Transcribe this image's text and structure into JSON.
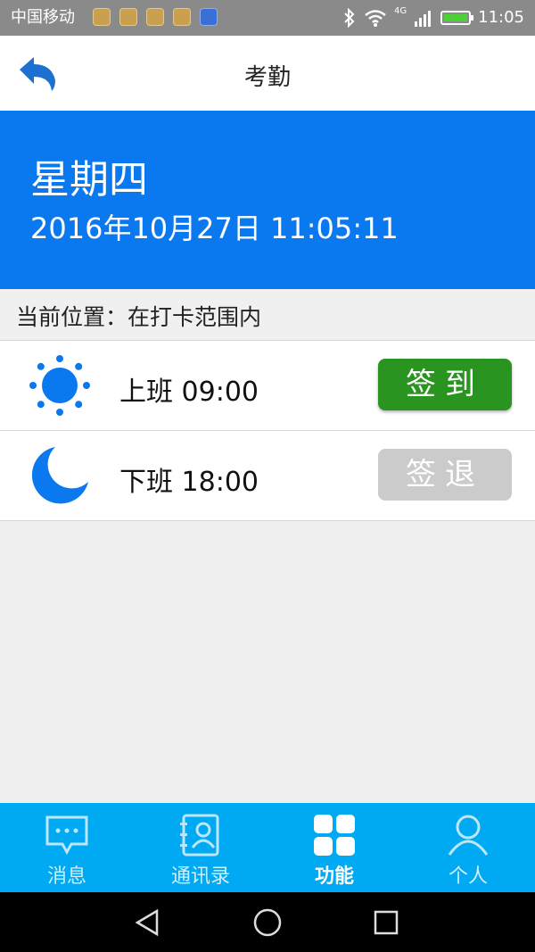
{
  "status_bar": {
    "carrier": "中国移动",
    "network": "4G",
    "time": "11:05"
  },
  "header": {
    "title": "考勤"
  },
  "banner": {
    "weekday": "星期四",
    "datetime": "2016年10月27日 11:05:11"
  },
  "location": {
    "text": "当前位置：在打卡范围内"
  },
  "rows": [
    {
      "label": "上班 09:00",
      "icon": "sun-icon",
      "button": "签到",
      "button_color": "#2a9421",
      "enabled": true
    },
    {
      "label": "下班 18:00",
      "icon": "moon-icon",
      "button": "签退",
      "button_color": "#cbcbcb",
      "enabled": false
    }
  ],
  "nav": [
    {
      "label": "消息",
      "icon": "message-icon",
      "active": false
    },
    {
      "label": "通讯录",
      "icon": "contacts-icon",
      "active": false
    },
    {
      "label": "功能",
      "icon": "grid-icon",
      "active": true
    },
    {
      "label": "个人",
      "icon": "person-icon",
      "active": false
    }
  ],
  "colors": {
    "accent": "#0a78ee",
    "nav_bg": "#00aaf2"
  }
}
